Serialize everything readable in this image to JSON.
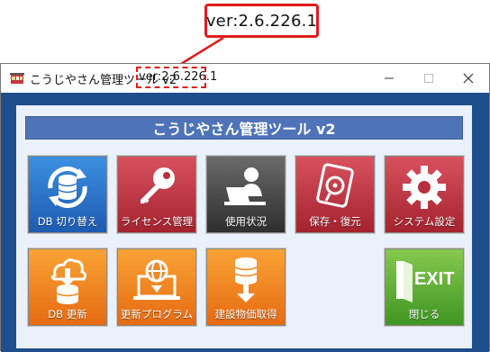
{
  "annotation": {
    "version_callout": "ver:2.6.226.1"
  },
  "window": {
    "title": "こうじやさん管理ツール v2",
    "version": "ver:2.6.226.1",
    "controls": {
      "minimize": "minimize",
      "maximize": "maximize",
      "close": "close"
    }
  },
  "banner": {
    "title": "こうじやさん管理ツール v2"
  },
  "tiles": {
    "db_switch": {
      "label": "DB 切り替え",
      "icon": "database-sync-icon"
    },
    "license": {
      "label": "ライセンス管理",
      "icon": "key-icon"
    },
    "usage": {
      "label": "使用状況",
      "icon": "user-laptop-icon"
    },
    "backup": {
      "label": "保存・復元",
      "icon": "disk-icon"
    },
    "settings": {
      "label": "システム設定",
      "icon": "gear-icon"
    },
    "db_update": {
      "label": "DB 更新",
      "icon": "cloud-download-icon"
    },
    "program_update": {
      "label": "更新プログラム",
      "icon": "globe-laptop-icon"
    },
    "price_fetch": {
      "label": "建設物価取得",
      "icon": "database-download-icon"
    },
    "exit": {
      "label": "閉じる",
      "text": "EXIT",
      "icon": "exit-door-icon"
    }
  },
  "colors": {
    "accent_red": "#e21b1b",
    "frame_blue": "#1f4e8c",
    "banner_blue": "#4e73b8",
    "tile_blue": "#1e5bb0",
    "tile_red": "#a5222f",
    "tile_dark": "#2e2e2e",
    "tile_orange": "#e66a12",
    "tile_green": "#3f9622"
  }
}
